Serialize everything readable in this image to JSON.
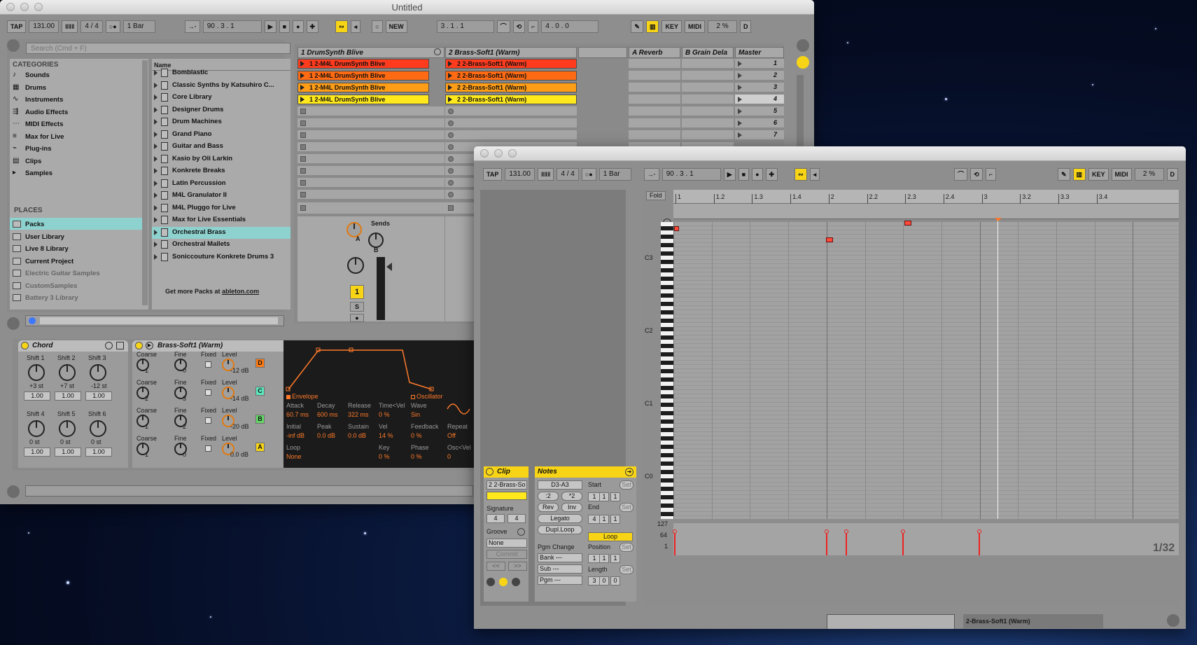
{
  "window1": {
    "title": "Untitled"
  },
  "transport": {
    "tap": "TAP",
    "tempo": "131.00",
    "sig": "4 / 4",
    "metro": "○●",
    "quant": "1 Bar",
    "pos": "90 .   3 .   1",
    "new": "NEW",
    "loop_start": "3 .   1 .   1",
    "loop_len": "4 .   0 .   0",
    "key": "KEY",
    "midi": "MIDI",
    "cpu": "2 %",
    "d": "D"
  },
  "browser": {
    "search_placeholder": "Search (Cmd + F)",
    "categories_title": "CATEGORIES",
    "categories": [
      "Sounds",
      "Drums",
      "Instruments",
      "Audio Effects",
      "MIDI Effects",
      "Max for Live",
      "Plug-ins",
      "Clips",
      "Samples"
    ],
    "places_title": "PLACES",
    "places": [
      "Packs",
      "User Library",
      "Live 8 Library",
      "Current Project",
      "Electric Guitar Samples",
      "CustomSamples",
      "Battery 3 Library"
    ],
    "name_header": "Name",
    "items": [
      "Bomblastic",
      "Classic Synths by Katsuhiro C...",
      "Core Library",
      "Designer Drums",
      "Drum Machines",
      "Grand Piano",
      "Guitar and Bass",
      "Kasio by Oli Larkin",
      "Konkrete Breaks",
      "Latin Percussion",
      "M4L Granulator II",
      "M4L Pluggo for Live",
      "Max for Live Essentials",
      "Orchestral Brass",
      "Orchestral Mallets",
      "Soniccouture Konkrete Drums 3"
    ],
    "footer_text": "Get more Packs at",
    "footer_link": "ableton.com"
  },
  "session": {
    "tracks": [
      "1 DrumSynth Blive",
      "2 Brass-Soft1 (Warm)",
      "A Reverb",
      "B Grain Dela",
      "Master"
    ],
    "clips1": [
      "1 2-M4L DrumSynth Blive",
      "1 2-M4L DrumSynth Blive",
      "1 2-M4L DrumSynth Blive",
      "1 2-M4L DrumSynth Blive"
    ],
    "clips2": [
      "2 2-Brass-Soft1 (Warm)",
      "2 2-Brass-Soft1 (Warm)",
      "2 2-Brass-Soft1 (Warm)",
      "2 2-Brass-Soft1 (Warm)"
    ],
    "clip_colors": [
      "#ff3b1e",
      "#ff6a12",
      "#ff9d17",
      "#ffe91d"
    ],
    "scenes": [
      "1",
      "2",
      "3",
      "4",
      "5",
      "6",
      "7"
    ],
    "sends": "Sends",
    "send_a": "A",
    "send_b": "B",
    "track_num": "1",
    "solo": "S"
  },
  "chord": {
    "title": "Chord",
    "shifts": [
      {
        "label": "Shift 1",
        "value": "+3 st",
        "vel": "1.00"
      },
      {
        "label": "Shift 2",
        "value": "+7 st",
        "vel": "1.00"
      },
      {
        "label": "Shift 3",
        "value": "-12 st",
        "vel": "1.00"
      },
      {
        "label": "Shift 4",
        "value": "0 st",
        "vel": "1.00"
      },
      {
        "label": "Shift 5",
        "value": "0 st",
        "vel": "1.00"
      },
      {
        "label": "Shift 6",
        "value": "0 st",
        "vel": "1.00"
      }
    ]
  },
  "operator": {
    "title": "Brass-Soft1 (Warm)",
    "oscs": [
      {
        "coarse": "1",
        "fine": "0",
        "level": "-12 dB",
        "letter": "D"
      },
      {
        "coarse": "2",
        "fine": "3",
        "level": "-14 dB",
        "letter": "C"
      },
      {
        "coarse": "1",
        "fine": "2",
        "level": "-20 dB",
        "letter": "B"
      },
      {
        "coarse": "1",
        "fine": "0",
        "level": "0.0 dB",
        "letter": "A"
      }
    ],
    "labels": {
      "coarse": "Coarse",
      "fine": "Fine",
      "fixed": "Fixed",
      "level": "Level"
    },
    "env": {
      "envelope": "Envelope",
      "oscillator": "Oscillator",
      "attack_l": "Attack",
      "attack": "60.7 ms",
      "decay_l": "Decay",
      "decay": "600 ms",
      "release_l": "Release",
      "release": "322 ms",
      "timevel_l": "Time<Vel",
      "timevel": "0 %",
      "wave_l": "Wave",
      "wave": "Sin",
      "initial_l": "Initial",
      "initial": "-inf dB",
      "peak_l": "Peak",
      "peak": "0.0 dB",
      "sustain_l": "Sustain",
      "sustain": "0.0 dB",
      "vel_l": "Vel",
      "vel": "14 %",
      "feedback_l": "Feedback",
      "feedback": "0 %",
      "repeat_l": "Repeat",
      "repeat": "Off",
      "loop_l": "Loop",
      "loop": "None",
      "key_l": "Key",
      "key": "0 %",
      "phase_l": "Phase",
      "phase": "0 %",
      "oscvel_l": "Osc<Vel",
      "oscvel": "0"
    }
  },
  "clipview": {
    "fold": "Fold",
    "ruler": [
      "1",
      "1.2",
      "1.3",
      "1.4",
      "2",
      "2.2",
      "2.3",
      "2.4",
      "3",
      "3.2",
      "3.3",
      "3.4"
    ],
    "notes_labels": [
      "C3",
      "C2",
      "C1",
      "C0"
    ],
    "vel_labels": [
      "127",
      "64",
      "1"
    ],
    "grid": "1/32",
    "clip_title": "Clip",
    "clip_name": "2 2-Brass-So",
    "signature": "Signature",
    "sig_num": "4",
    "sig_den": "4",
    "groove": "Groove",
    "groove_val": "None",
    "commit": "Commit",
    "notes_title": "Notes",
    "range": "D3-A3",
    "div": ":2",
    "mul": "*2",
    "rev": "Rev",
    "inv": "Inv",
    "legato": "Legato",
    "dupl": "Dupl.Loop",
    "pgm_change": "Pgm Change",
    "bank": "Bank ---",
    "sub": "Sub ---",
    "pgm": "Pgm ---",
    "start": "Start",
    "set": "Set",
    "end": "End",
    "loop": "Loop",
    "position": "Position",
    "length": "Length",
    "start_v": [
      "1",
      "1",
      "1"
    ],
    "end_v": [
      "4",
      "1",
      "1"
    ],
    "pos_v": [
      "1",
      "1",
      "1"
    ],
    "len_v": [
      "3",
      "0",
      "0"
    ],
    "track_label": "2-Brass-Soft1 (Warm)"
  }
}
